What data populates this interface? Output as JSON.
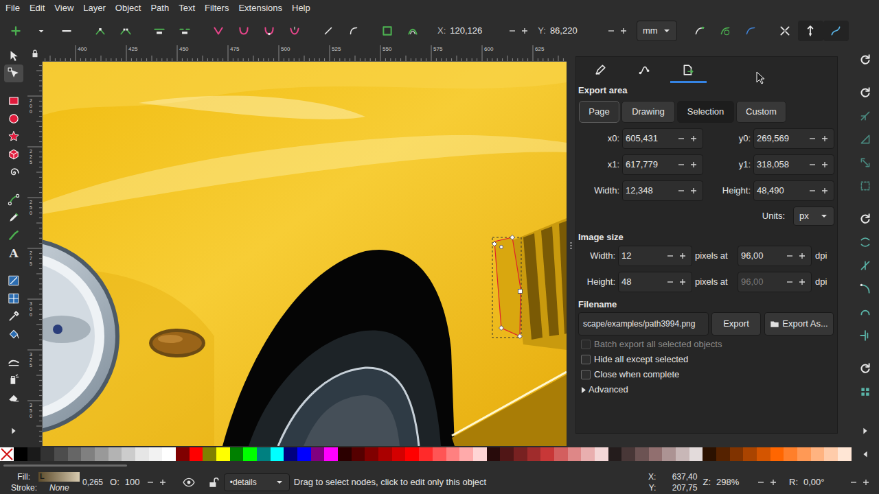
{
  "menu": [
    "File",
    "Edit",
    "View",
    "Layer",
    "Object",
    "Path",
    "Text",
    "Filters",
    "Extensions",
    "Help"
  ],
  "toolbar": {
    "x_label": "X:",
    "x_value": "120,126",
    "y_label": "Y:",
    "y_value": "86,220",
    "units": "mm"
  },
  "toolbox": [
    {
      "selected": false
    },
    {
      "selected": true
    },
    {
      "selected": false
    },
    {
      "selected": false
    },
    {
      "selected": false
    },
    {
      "selected": false
    },
    {
      "selected": false
    },
    {
      "selected": false
    },
    {
      "selected": false
    },
    {
      "selected": false
    },
    {
      "selected": false,
      "glyph": "A"
    },
    {
      "selected": false
    },
    {
      "selected": false
    },
    {
      "selected": false
    },
    {
      "selected": false
    },
    {
      "selected": false
    },
    {
      "selected": false
    },
    {
      "selected": false
    }
  ],
  "rulers": {
    "top": [
      "400",
      "425",
      "450",
      "475",
      "500",
      "525",
      "550",
      "575",
      "600",
      "625"
    ],
    "left": [
      "200",
      "225",
      "250",
      "275",
      "300",
      "325",
      "350"
    ]
  },
  "export": {
    "tabs": [
      {
        "selected": false
      },
      {
        "selected": false
      },
      {
        "selected": true
      }
    ],
    "area_title": "Export area",
    "area_buttons": [
      {
        "label": "Page",
        "selected": false
      },
      {
        "label": "Drawing",
        "selected": false
      },
      {
        "label": "Selection",
        "selected": true
      },
      {
        "label": "Custom",
        "selected": false
      }
    ],
    "coords": [
      {
        "label": "x0:",
        "value": "605,431"
      },
      {
        "label": "y0:",
        "value": "269,569"
      },
      {
        "label": "x1:",
        "value": "617,779"
      },
      {
        "label": "y1:",
        "value": "318,058"
      },
      {
        "label": "Width:",
        "value": "12,348"
      },
      {
        "label": "Height:",
        "value": "48,490"
      }
    ],
    "units_label": "Units:",
    "units": "px",
    "image_title": "Image size",
    "image_rows": [
      {
        "label": "Width:",
        "pixels": "12",
        "at": "pixels at",
        "dpi": "96,00",
        "dpi_disabled": false,
        "unit": "dpi"
      },
      {
        "label": "Height:",
        "pixels": "48",
        "at": "pixels at",
        "dpi": "96,00",
        "dpi_disabled": true,
        "unit": "dpi"
      }
    ],
    "filename_title": "Filename",
    "filename": "scape/examples/path3994.png",
    "export_button": "Export",
    "export_as_button": "Export As...",
    "checkboxes": [
      {
        "label": "Batch export all selected objects",
        "checked": false,
        "disabled": true
      },
      {
        "label": "Hide all except selected",
        "checked": false,
        "disabled": false
      },
      {
        "label": "Close when complete",
        "checked": false,
        "disabled": false
      }
    ],
    "advanced": {
      "label": "Advanced",
      "expanded": false
    }
  },
  "palette": [
    {
      "color": "#000000"
    },
    {
      "color": "#1a1a1a"
    },
    {
      "color": "#333333"
    },
    {
      "color": "#4d4d4d"
    },
    {
      "color": "#666666"
    },
    {
      "color": "#808080"
    },
    {
      "color": "#999999"
    },
    {
      "color": "#b3b3b3"
    },
    {
      "color": "#cccccc"
    },
    {
      "color": "#e6e6e6"
    },
    {
      "color": "#f2f2f2"
    },
    {
      "color": "#ffffff"
    },
    {
      "color": "#800000"
    },
    {
      "color": "#ff0000"
    },
    {
      "color": "#808000"
    },
    {
      "color": "#ffff00"
    },
    {
      "color": "#008000"
    },
    {
      "color": "#00ff00"
    },
    {
      "color": "#008080"
    },
    {
      "color": "#00ffff"
    },
    {
      "color": "#000080"
    },
    {
      "color": "#0000ff"
    },
    {
      "color": "#800080"
    },
    {
      "color": "#ff00ff"
    },
    {
      "color": "#2b0000"
    },
    {
      "color": "#550000"
    },
    {
      "color": "#800000"
    },
    {
      "color": "#aa0000"
    },
    {
      "color": "#d40000"
    },
    {
      "color": "#ff0000"
    },
    {
      "color": "#ff2a2a"
    },
    {
      "color": "#ff5555"
    },
    {
      "color": "#ff8080"
    },
    {
      "color": "#ffaaaa"
    },
    {
      "color": "#ffd5d5"
    },
    {
      "color": "#280b0b"
    },
    {
      "color": "#501616"
    },
    {
      "color": "#782121"
    },
    {
      "color": "#a02c2c"
    },
    {
      "color": "#c83737"
    },
    {
      "color": "#d35f5f"
    },
    {
      "color": "#de8787"
    },
    {
      "color": "#e9afaf"
    },
    {
      "color": "#f4d7d7"
    },
    {
      "color": "#241c1c"
    },
    {
      "color": "#483737"
    },
    {
      "color": "#6c5353"
    },
    {
      "color": "#916f6f"
    },
    {
      "color": "#ac9393"
    },
    {
      "color": "#c8b7b7"
    },
    {
      "color": "#e3dbdb"
    },
    {
      "color": "#2b1100"
    },
    {
      "color": "#552200"
    },
    {
      "color": "#803300"
    },
    {
      "color": "#aa4400"
    },
    {
      "color": "#d45500"
    },
    {
      "color": "#ff6600"
    },
    {
      "color": "#ff7f2a"
    },
    {
      "color": "#ff9955"
    },
    {
      "color": "#ffb380"
    },
    {
      "color": "#ffccaa"
    },
    {
      "color": "#ffe6d5"
    }
  ],
  "status": {
    "fill_label": "Fill:",
    "fill_value": "L",
    "stroke_label": "Stroke:",
    "stroke_value": "None",
    "stroke_width": "0,265",
    "opacity_label": "O:",
    "opacity": "100",
    "layer": "•details",
    "message": "Drag to select nodes, click to edit only this object",
    "x_label": "X:",
    "x": "637,40",
    "y_label": "Y:",
    "y": "207,75",
    "zoom_label": "Z:",
    "zoom": "298%",
    "rotation_label": "R:",
    "rotation": "0,00°"
  }
}
